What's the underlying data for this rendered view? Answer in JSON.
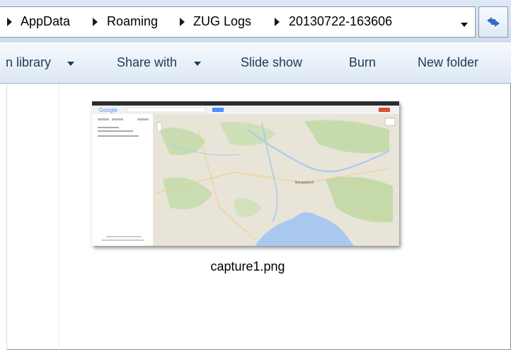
{
  "address_bar": {
    "crumbs": [
      "AppData",
      "Roaming",
      "ZUG Logs",
      "20130722-163606"
    ]
  },
  "command_bar": {
    "include_in_library": "n library",
    "share_with": "Share with",
    "slide_show": "Slide show",
    "burn": "Burn",
    "new_folder": "New folder"
  },
  "file": {
    "name": "capture1.png",
    "thumbnail": {
      "logo_text": "Google",
      "map_label": "Bangladesh"
    }
  },
  "icons": {
    "breadcrumb_separator": "triangle-right",
    "dropdown": "triangle-down",
    "refresh": "refresh-arrows"
  },
  "colors": {
    "command_text": "#1e395b",
    "map_water": "#a8c8f0",
    "map_land": "#e8e4d8",
    "google_red": "#dd4b39",
    "google_blue": "#4d90fe"
  }
}
